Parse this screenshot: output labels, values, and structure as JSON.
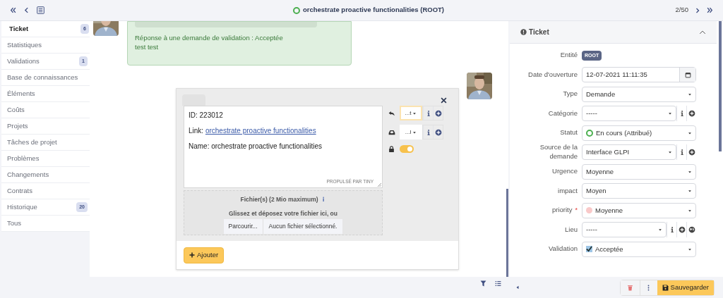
{
  "topbar": {
    "title": "orchestrate proactive functionalities (ROOT)",
    "status": {
      "color": "#4caf50"
    },
    "counter": "2/50"
  },
  "sidebar": {
    "items": [
      {
        "label": "Ticket",
        "badge": "6",
        "selected": true
      },
      {
        "label": "Statistiques",
        "selected": false
      },
      {
        "label": "Validations",
        "badge": "1",
        "selected": false
      },
      {
        "label": "Base de connaissances",
        "selected": false
      },
      {
        "label": "Éléments",
        "selected": false
      },
      {
        "label": "Coûts",
        "selected": false
      },
      {
        "label": "Projets",
        "selected": false
      },
      {
        "label": "Tâches de projet",
        "selected": false
      },
      {
        "label": "Problèmes",
        "selected": false
      },
      {
        "label": "Changements",
        "selected": false
      },
      {
        "label": "Contrats",
        "selected": false
      },
      {
        "label": "Historique",
        "badge": "20",
        "selected": false
      },
      {
        "label": "Tous",
        "selected": false
      }
    ]
  },
  "validation_message": {
    "lines": [
      "Réponse à une demande de validation : Acceptée",
      "test test"
    ]
  },
  "editor": {
    "id_line": "ID: 223012",
    "link_prefix": "Link: ",
    "link_text": "orchestrate proactive functionalities",
    "name_line": "Name: orchestrate proactive functionalities",
    "branding": "PROPULSÉ PAR TINY",
    "selects": [
      {
        "kind": "reply",
        "value": "...t",
        "focused": true
      },
      {
        "kind": "inbox",
        "value": "...l",
        "focused": false
      }
    ],
    "private_toggle": {
      "on": true
    },
    "files": {
      "title": "Fichier(s) (2 Mio maximum)",
      "drop_text": "Glissez et déposez votre fichier ici, ou",
      "browse": "Parcourir...",
      "status": "Aucun fichier sélectionné."
    },
    "add_button": "Ajouter"
  },
  "panel": {
    "title": "Ticket",
    "fields": [
      {
        "label": "Entité",
        "kind": "badge",
        "value": "ROOT"
      },
      {
        "label": "Date d'ouverture",
        "kind": "date",
        "value": "12-07-2021 11:11:35"
      },
      {
        "label": "Type",
        "kind": "select",
        "value": "Demande"
      },
      {
        "label": "Catégorie",
        "kind": "select",
        "value": "-----",
        "actions": [
          {
            "kind": "info"
          },
          {
            "kind": "add"
          }
        ]
      },
      {
        "label": "Statut",
        "kind": "select",
        "value": "En cours (Attribué)",
        "marker": {
          "kind": "ring",
          "color": "#4caf50"
        }
      },
      {
        "label": "Source de la demande",
        "kind": "select",
        "value": "Interface GLPI",
        "actions": [
          {
            "kind": "info"
          },
          {
            "kind": "add"
          }
        ]
      },
      {
        "label": "Urgence",
        "kind": "select",
        "value": "Moyenne"
      },
      {
        "label": "impact",
        "kind": "select",
        "value": "Moyen"
      },
      {
        "label": "priority",
        "kind": "select",
        "value": "Moyenne",
        "required_mark": "*",
        "marker": {
          "kind": "dot",
          "color": "#f9c9c9"
        }
      },
      {
        "label": "Lieu",
        "kind": "select",
        "value": "-----",
        "actions": [
          {
            "kind": "info"
          },
          {
            "kind": "add"
          },
          {
            "kind": "globe"
          }
        ]
      },
      {
        "label": "Validation",
        "kind": "select",
        "value": "Acceptée",
        "marker": {
          "kind": "checkbox",
          "checked": true
        }
      }
    ],
    "save_button": "Sauvegarder"
  }
}
